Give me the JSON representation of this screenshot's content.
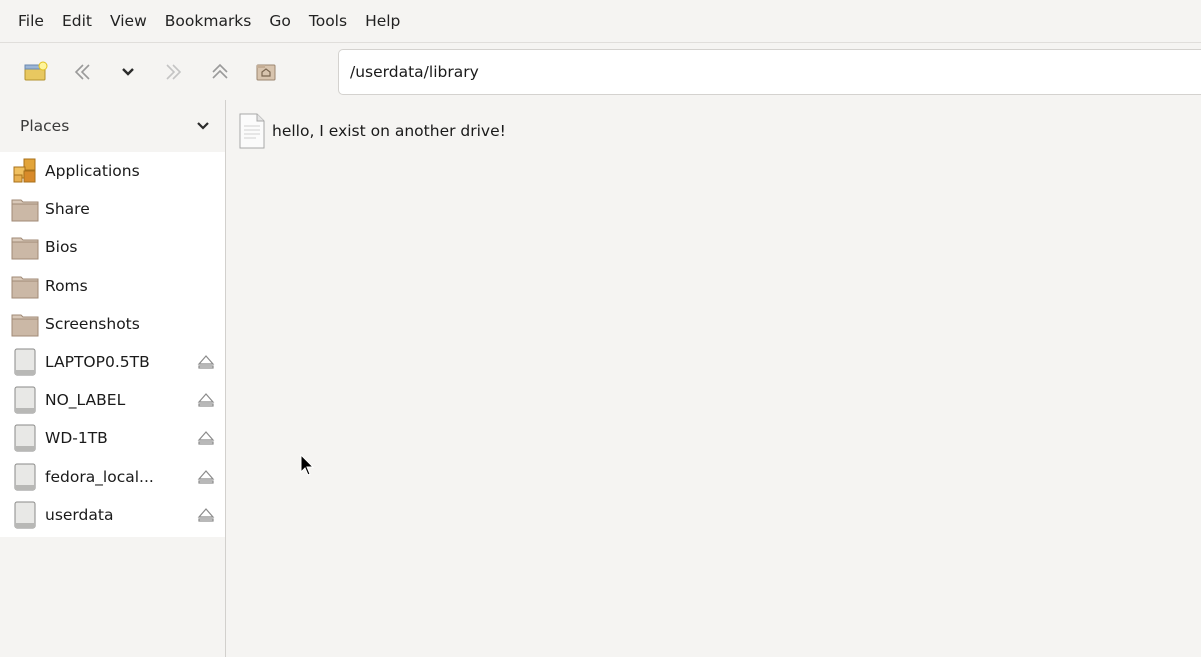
{
  "menubar": {
    "items": [
      "File",
      "Edit",
      "View",
      "Bookmarks",
      "Go",
      "Tools",
      "Help"
    ]
  },
  "toolbar": {
    "buttons": [
      {
        "name": "new-window-icon"
      },
      {
        "name": "back-icon"
      },
      {
        "name": "history-dropdown-icon"
      },
      {
        "name": "forward-icon"
      },
      {
        "name": "up-icon"
      },
      {
        "name": "home-icon"
      }
    ],
    "location": "/userdata/library"
  },
  "sidebar": {
    "header": "Places",
    "items": [
      {
        "label": "Applications",
        "icon": "applications-icon",
        "eject": false
      },
      {
        "label": "Share",
        "icon": "folder-icon",
        "eject": false
      },
      {
        "label": "Bios",
        "icon": "folder-icon",
        "eject": false
      },
      {
        "label": "Roms",
        "icon": "folder-icon",
        "eject": false
      },
      {
        "label": "Screenshots",
        "icon": "folder-icon",
        "eject": false
      },
      {
        "label": "LAPTOP0.5TB",
        "icon": "drive-icon",
        "eject": true
      },
      {
        "label": "NO_LABEL",
        "icon": "drive-icon",
        "eject": true
      },
      {
        "label": "WD-1TB",
        "icon": "drive-icon",
        "eject": true
      },
      {
        "label": "fedora_local...",
        "icon": "drive-icon",
        "eject": true
      },
      {
        "label": "userdata",
        "icon": "drive-icon",
        "eject": true
      }
    ]
  },
  "content": {
    "files": [
      {
        "name": "hello, I exist on another drive!",
        "icon": "text-file-icon"
      }
    ]
  },
  "colors": {
    "background": "#f5f4f2",
    "sidebar_list": "#ffffff",
    "folder": "#c9b8a8"
  }
}
